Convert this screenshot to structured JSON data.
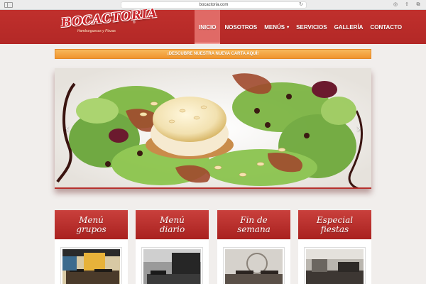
{
  "browser": {
    "url": "bocactoria.com"
  },
  "logo": {
    "name": "BOCACTORIA",
    "tagline": "Hamburguesas y Pizzas",
    "reg": "®"
  },
  "nav": {
    "items": [
      "INICIO",
      "NOSOTROS",
      "MENÚS",
      "SERVICIOS",
      "GALLERÍA",
      "CONTACTO"
    ],
    "active": "INICIO",
    "menus_caret": "▾"
  },
  "banner": {
    "text": "¡DESCUBRE NUESTRA NUEVA CARTA AQUÍ!"
  },
  "slider": {
    "prev": "‹",
    "next": "›"
  },
  "cards": [
    {
      "title": "Menú\ngrupos"
    },
    {
      "title": "Menú\ndiario"
    },
    {
      "title": "Fin de\nsemana"
    },
    {
      "title": "Especial\nfiestas"
    }
  ],
  "colors": {
    "header": "#b32826",
    "active_nav": "#e06a66",
    "banner": "#f0942d",
    "card_header": "#a9211f"
  }
}
